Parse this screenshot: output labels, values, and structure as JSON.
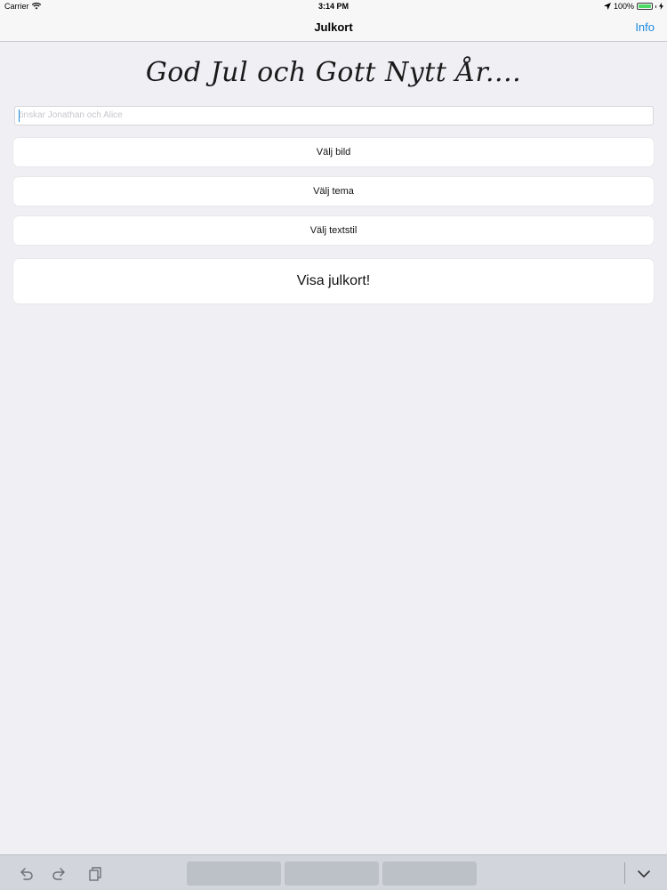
{
  "status_bar": {
    "carrier": "Carrier",
    "time": "3:14 PM",
    "battery_pct": "100%",
    "battery_color": "#4cd964"
  },
  "nav": {
    "title": "Julkort",
    "info_label": "Info",
    "accent_color": "#1a8ae0"
  },
  "headline": "God Jul och Gott Nytt År....",
  "text_field": {
    "placeholder": "önskar Jonathan och Alice"
  },
  "buttons": {
    "choose_image": "Välj bild",
    "choose_theme": "Välj tema",
    "choose_text_style": "Välj textstil",
    "show_card": "Visa julkort!"
  },
  "keyboard_toolbar": {
    "icons": [
      "undo-icon",
      "redo-icon",
      "paste-icon",
      "keyboard-dismiss-icon"
    ]
  }
}
